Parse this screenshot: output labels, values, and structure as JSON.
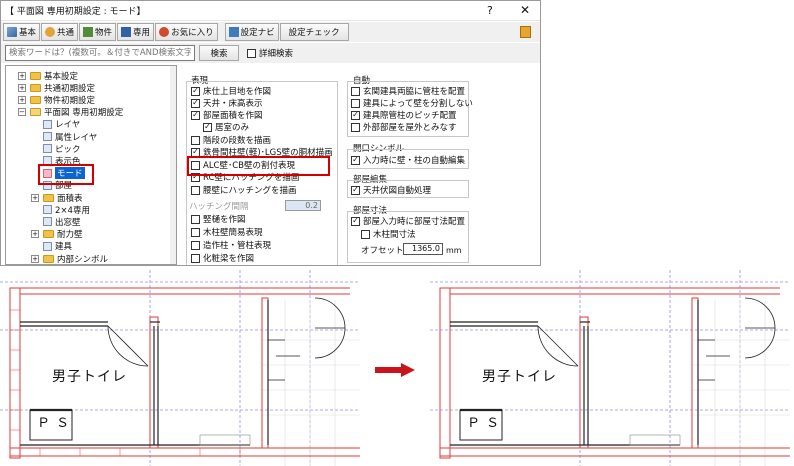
{
  "dialog": {
    "title": "【 平面図 専用初期設定 : モード】",
    "help_glyph": "?",
    "close_glyph": "✕"
  },
  "toolbar": {
    "items": [
      "基本",
      "共通",
      "物件",
      "専用",
      "お気に入り"
    ],
    "dropdown_glyph": "▼",
    "navi_label": "設定ナビ",
    "check_label": "設定チェック"
  },
  "search": {
    "placeholder": "検索ワードは？(複数可。＆付きでAND検索文字)",
    "button": "検索",
    "detail_label": "詳細検索"
  },
  "tree": {
    "items": [
      {
        "label": "基本設定",
        "level": 1,
        "expander": "+"
      },
      {
        "label": "共通初期設定",
        "level": 1,
        "expander": "+"
      },
      {
        "label": "物件初期設定",
        "level": 1,
        "expander": "+"
      },
      {
        "label": "平面図 専用初期設定",
        "level": 1,
        "expander": "−"
      },
      {
        "label": "レイヤ",
        "level": 2
      },
      {
        "label": "属性レイヤ",
        "level": 2
      },
      {
        "label": "ピック",
        "level": 2
      },
      {
        "label": "表示色",
        "level": 2
      },
      {
        "label": "モード",
        "level": 2,
        "selected": true
      },
      {
        "label": "部屋",
        "level": 2
      },
      {
        "label": "面積表",
        "level": 2,
        "expander": "+"
      },
      {
        "label": "2×4専用",
        "level": 2
      },
      {
        "label": "出窓壁",
        "level": 2
      },
      {
        "label": "耐力壁",
        "level": 2,
        "expander": "+"
      },
      {
        "label": "建具",
        "level": 2
      },
      {
        "label": "内部シンボル",
        "level": 2,
        "expander": "+"
      }
    ]
  },
  "display_group": {
    "title": "表現",
    "options": [
      {
        "label": "床仕上目地を作図",
        "checked": true
      },
      {
        "label": "天井・床高表示",
        "checked": true
      },
      {
        "label": "部屋面積を作図",
        "checked": true
      },
      {
        "label": "居室のみ",
        "checked": true
      },
      {
        "label": "階段の段数を描画",
        "checked": false
      },
      {
        "label": "鉄骨間柱壁(軽)･LGS壁の胴材描画",
        "checked": true
      },
      {
        "label": "ALC壁･CB壁の割付表現",
        "checked": false
      },
      {
        "label": "RC壁にハッチングを描画",
        "checked": true
      },
      {
        "label": "腰壁にハッチングを描画",
        "checked": false
      },
      {
        "label": "竪樋を作図",
        "checked": false
      },
      {
        "label": "木柱壁簡易表現",
        "checked": false
      },
      {
        "label": "造作柱・管柱表現",
        "checked": false
      },
      {
        "label": "化粧梁を作図",
        "checked": false
      }
    ],
    "hatch_label": "ハッチング間隔",
    "hatch_value": "0.2"
  },
  "auto_group": {
    "title": "自動",
    "options": [
      {
        "label": "玄関建具両脇に管柱を配置",
        "checked": false
      },
      {
        "label": "建具によって壁を分割しない",
        "checked": false
      },
      {
        "label": "建具際管柱のピッチ配置",
        "checked": true
      },
      {
        "label": "外部部屋を屋外とみなす",
        "checked": false
      }
    ]
  },
  "opening_group": {
    "title": "開口シンボル",
    "options": [
      {
        "label": "入力時に壁・柱の自動編集",
        "checked": true
      }
    ]
  },
  "room_edit_group": {
    "title": "部屋編集",
    "options": [
      {
        "label": "天井伏図自動処理",
        "checked": true
      }
    ]
  },
  "room_dim_group": {
    "title": "部屋寸法",
    "options": [
      {
        "label": "部屋入力時に部屋寸法配置",
        "checked": true
      },
      {
        "label": "木柱間寸法",
        "checked": false
      }
    ],
    "offset_label": "オフセット",
    "offset_value": "1365.0",
    "offset_unit": "mm"
  },
  "drawings": {
    "room_name": "男子トイレ",
    "ps_label": "ＰＳ"
  },
  "colors": {
    "highlight": "#d40000",
    "selection": "#0a64d2",
    "wall_red": "#e23a3a",
    "guide_blue": "#9a8fd8",
    "arrow": "#c8141a"
  }
}
